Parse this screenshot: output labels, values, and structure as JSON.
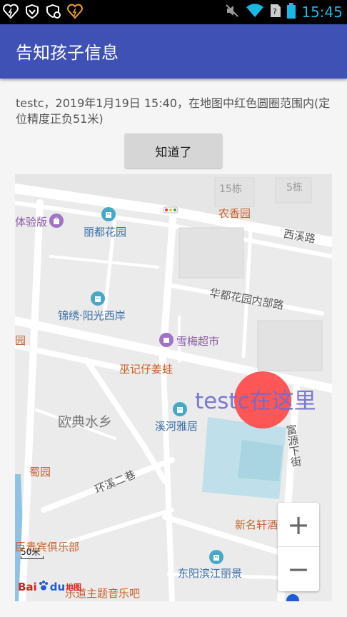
{
  "status_bar": {
    "time": "15:45",
    "icons": [
      "heart-icon",
      "shield-icon",
      "shield-gear-icon",
      "heart-icon",
      "mute-icon",
      "wifi-icon",
      "sim-icon",
      "battery-icon"
    ]
  },
  "app_bar": {
    "title": "告知孩子信息"
  },
  "message": {
    "text": "testc，2019年1月19日 15:40，在地图中红色圆圈范围内(定位精度正负51米)"
  },
  "buttons": {
    "ok_label": "知道了"
  },
  "map": {
    "location_label": "testc在这里",
    "labels": {
      "b15": "15栋",
      "b5": "5栋",
      "nongxiangyuan": "农香园",
      "tiyanban": "体验版",
      "liduhuayuan": "丽都花园",
      "xixilu": "西溪路",
      "huaduneibulu": "华都花园内部路",
      "jinxiu": "锦绣·阳光西岸",
      "xuemei": "雪梅超市",
      "yuan": "园",
      "wuji": "巫记仔姜蛙",
      "oudian": "欧典水乡",
      "xiheyaju": "溪河雅居",
      "fuyuanxiajie": "富源下街",
      "shuyuan": "蜀园",
      "huanxiersiang": "环溪二巷",
      "xinmingxuan": "新名轩酒",
      "guibin": "臣贵宾俱乐部",
      "dongyang": "东阳滨江丽景",
      "music": "乐道主题音乐吧"
    },
    "scale_label": "50米",
    "logo": {
      "bai": "Bai",
      "du": "du",
      "ditu": "地图"
    },
    "zoom_in": "+",
    "zoom_out": "−"
  },
  "colors": {
    "app_bar": "#3f51b5",
    "clock": "#18b9e4",
    "location_circle": "#ff3c3c",
    "location_text": "#6d6dd0"
  }
}
